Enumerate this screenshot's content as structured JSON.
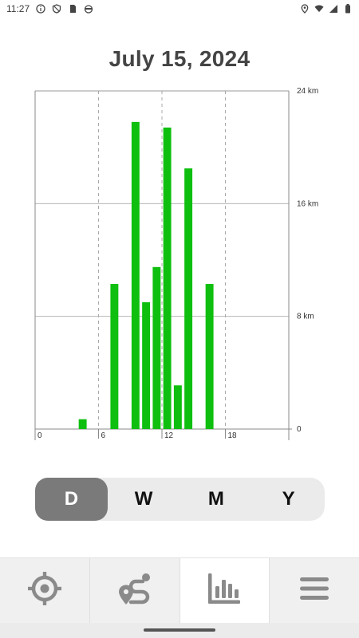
{
  "status_bar": {
    "time": "11:27",
    "left_icons": [
      "info-icon",
      "shield-icon",
      "sim-card-icon",
      "cat-icon"
    ],
    "right_icons": [
      "location-icon",
      "wifi-icon",
      "signal-icon",
      "battery-icon"
    ]
  },
  "header": {
    "date": "July 15, 2024"
  },
  "chart_data": {
    "type": "bar",
    "title": "July 15, 2024",
    "xlabel": "",
    "ylabel": "",
    "x_ticks": [
      "0",
      "6",
      "12",
      "18"
    ],
    "y_ticks": [
      "0",
      "8 km",
      "16 km",
      "24 km"
    ],
    "xlim": [
      0,
      24
    ],
    "ylim": [
      0,
      24
    ],
    "y_unit": "km",
    "grid": true,
    "color": "#0fbf0f",
    "x": [
      4,
      7,
      9,
      10,
      11,
      12,
      13,
      14,
      16
    ],
    "values": [
      0.7,
      10.3,
      21.8,
      9.0,
      11.5,
      21.4,
      3.1,
      18.5,
      10.3
    ]
  },
  "period_selector": {
    "options": [
      {
        "label": "D",
        "active": true
      },
      {
        "label": "W",
        "active": false
      },
      {
        "label": "M",
        "active": false
      },
      {
        "label": "Y",
        "active": false
      }
    ]
  },
  "bottom_nav": {
    "items": [
      {
        "icon": "crosshair-icon",
        "active": false
      },
      {
        "icon": "route-icon",
        "active": false
      },
      {
        "icon": "bar-chart-icon",
        "active": true
      },
      {
        "icon": "menu-icon",
        "active": false
      }
    ]
  }
}
